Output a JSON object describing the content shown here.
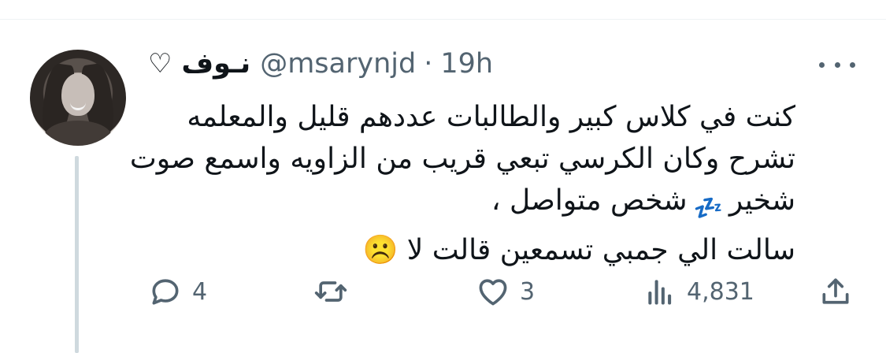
{
  "tweet": {
    "display_name": "نـوف",
    "name_suffix": "♡",
    "handle": "@msarynjd",
    "separator": "·",
    "time": "19h",
    "lines": [
      "كنت في كلاس كبير والطالبات عددهم قليل والمعلمه",
      "تشرح وكان الكرسي تبعي قريب من الزاويه واسمع صوت",
      "شخير",
      "شخص متواصل ،",
      "سالت الي جمبي تسمعين قالت لا"
    ],
    "sleep_emoji": "💤",
    "frown_emoji": "☹️"
  },
  "actions": {
    "replies": "4",
    "reposts": "",
    "likes": "3",
    "views": "4,831"
  },
  "icons": {
    "reply": "speech-bubble-icon",
    "repost": "repost-arrows-icon",
    "like": "heart-icon",
    "views": "bar-chart-icon",
    "share": "share-upload-icon",
    "more": "more-dots-icon"
  },
  "colors": {
    "text": "#0f1419",
    "muted": "#536471",
    "thread_line": "#cfd9de",
    "zzz_blue": "#1d78e9"
  }
}
